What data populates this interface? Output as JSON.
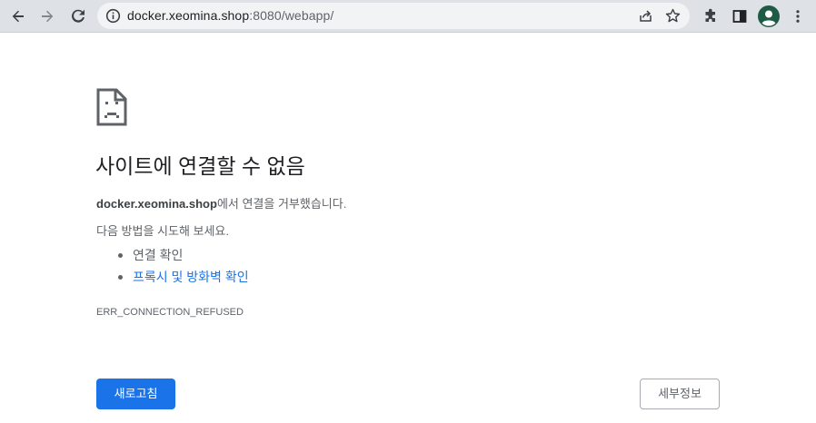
{
  "browser": {
    "url_host": "docker.xeomina.shop",
    "url_rest": ":8080/webapp/",
    "icons": {
      "back": "back-arrow-icon",
      "forward": "forward-arrow-icon",
      "reload": "reload-icon",
      "site_info": "info-icon",
      "share": "share-icon",
      "bookmark": "star-icon",
      "extensions": "puzzle-icon",
      "side_panel": "side-panel-icon",
      "profile": "avatar-icon",
      "menu": "kebab-menu-icon"
    }
  },
  "error_page": {
    "icon": "sad-document-icon",
    "heading": "사이트에 연결할 수 없음",
    "summary_domain": "docker.xeomina.shop",
    "summary_rest": "에서 연결을 거부했습니다.",
    "suggestions_intro": "다음 방법을 시도해 보세요.",
    "suggestions": [
      {
        "label": "연결 확인",
        "link": false
      },
      {
        "label": "프록시 및 방화벽 확인",
        "link": true
      }
    ],
    "error_code": "ERR_CONNECTION_REFUSED",
    "reload_label": "새로고침",
    "details_label": "세부정보"
  },
  "colors": {
    "accent": "#1a73e8",
    "toolbar_bg": "#dee1e6",
    "omnibox_bg": "#f1f3f4",
    "text_secondary": "#5f6368",
    "avatar": "#1e5b45"
  }
}
